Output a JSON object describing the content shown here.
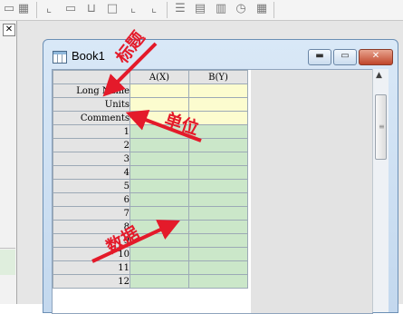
{
  "window": {
    "title": "Book1"
  },
  "columns": [
    "A(X)",
    "B(Y)"
  ],
  "meta_rows": [
    "Long Name",
    "Units",
    "Comments"
  ],
  "data_rows": [
    "1",
    "2",
    "3",
    "4",
    "5",
    "6",
    "7",
    "8",
    "9",
    "10",
    "11",
    "12"
  ],
  "annotations": {
    "title": "标题",
    "units": "单位",
    "data": "数据"
  },
  "colors": {
    "meta_fill": "#fcfccf",
    "data_fill": "#cbe7c9",
    "annotation": "#e41a2a"
  }
}
